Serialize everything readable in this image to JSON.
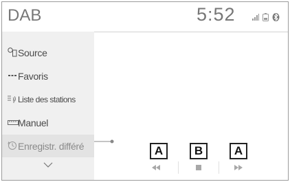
{
  "header": {
    "title": "DAB",
    "clock": "5:52"
  },
  "status_icons": [
    "signal-icon",
    "phone-battery-icon",
    "bluetooth-icon"
  ],
  "sidebar": {
    "items": [
      {
        "label": "Source",
        "icon": "source-icon"
      },
      {
        "label": "Favoris",
        "icon": "favorites-icon"
      },
      {
        "label": "Liste des stations",
        "icon": "station-list-icon"
      },
      {
        "label": "Manuel",
        "icon": "manual-tune-icon"
      },
      {
        "label": "Enregistr. différé",
        "icon": "clock-icon",
        "active": true
      }
    ],
    "more_icon": "chevron-down-icon"
  },
  "controls": [
    {
      "icon": "rewind-icon",
      "callout": "A"
    },
    {
      "icon": "stop-icon",
      "callout": "B"
    },
    {
      "icon": "fast-forward-icon",
      "callout": "A"
    }
  ],
  "colors": {
    "text": "#4a4a4a",
    "sidebar_bg": "#f0f0f0",
    "icon_gray": "#9a9a9a"
  }
}
